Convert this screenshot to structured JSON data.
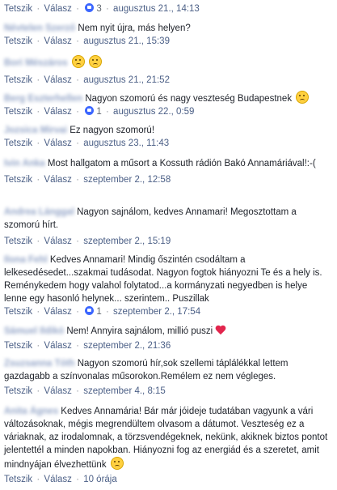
{
  "labels": {
    "reply": "Tetszik",
    "answer": "Válasz",
    "sep": "·"
  },
  "comments": [
    {
      "author": "",
      "text": "",
      "like_count": "3",
      "time": "augusztus 21., 14:13"
    },
    {
      "author": "Névtelen Szerző",
      "text": "Nem nyit újra, más helyen?",
      "like_count": "",
      "time": "augusztus 21., 15:39"
    },
    {
      "author": "Bori Mészáros",
      "text": "",
      "like_count": "",
      "time": "augusztus 21., 21:52"
    },
    {
      "author": "Berg Eszterhellen",
      "text": "Nagyon szomorú és nagy veszteség Budapestnek",
      "like_count": "1",
      "time": "augusztus 22., 0:59"
    },
    {
      "author": "Jozsica Mirvai",
      "text": "Ez nagyon szomorú!",
      "like_count": "",
      "time": "augusztus 23., 11:43"
    },
    {
      "author": "Ivin Anka",
      "text": "Most hallgatom a műsort a Kossuth rádión Bakó Annamáriával!:-(",
      "like_count": "",
      "time": "szeptember 2., 12:58"
    },
    {
      "author": "Andrea Lánggal",
      "text": "Nagyon sajnálom, kedves Annamari! Megosztottam a szomorú hírt.",
      "like_count": "",
      "time": "szeptember 2., 15:19"
    },
    {
      "author": "Ilona Fehl",
      "text": "Kedves Annamari! Mindig őszintén csodáltam a lelkesedésedet...szakmai tudásodat. Nagyon fogtok hiányozni Te és a hely is. Reménykedem hogy valahol folytatod...a kormányzati negyedben is helye lenne egy hasonló helynek... szerintem.. Puszillak",
      "like_count": "1",
      "time": "szeptember 2., 17:54"
    },
    {
      "author": "Sámuel Ildikó",
      "text": "Nem! Annyira sajnálom, millió puszi",
      "like_count": "",
      "time": "szeptember 2., 21:36"
    },
    {
      "author": "Zsuzsanna Tóth",
      "text": "Nagyon szomorú hír,sok szellemi táplálékkal lettem gazdagabb a színvonalas műsorokon.Remélem ez nem végleges.",
      "like_count": "",
      "time": "szeptember 4., 8:15"
    },
    {
      "author": "Anita Ágnes",
      "text": "Kedves Annamária! Bár már jóideje tudatában vagyunk a vári változásoknak, mégis megrendültem olvasom a dátumot. Veszteség ez a váriaknak, az irodalomnak, a törzsvendégeknek, nekünk, akiknek biztos pontot jelentettél a minden napokban. Hiányozni fog az energiád és a szeretet, amit mindnyájan élvezhettünk",
      "like_count": "",
      "time": "10 órája"
    }
  ]
}
